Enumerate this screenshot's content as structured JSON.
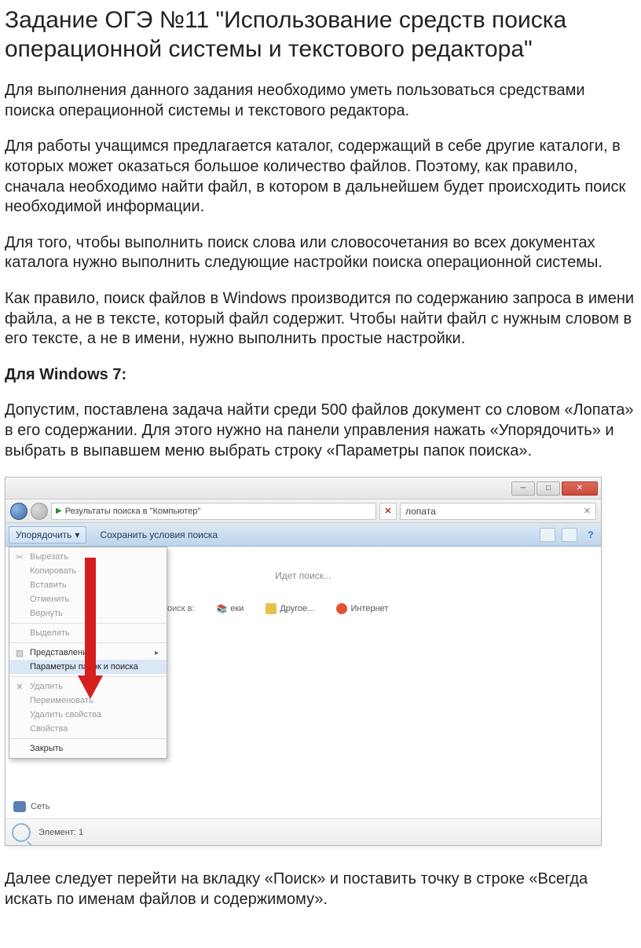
{
  "title": "Задание ОГЭ №11 \"Использование средств поиска операционной системы и текстового редактора\"",
  "p1": "Для выполнения данного задания необходимо уметь пользоваться средствами поиска операционной системы и текстового редактора.",
  "p2": "Для работы учащимся предлагается каталог, содержащий в себе другие каталоги, в которых может оказаться большое количество файлов. Поэтому, как правило, сначала необходимо найти файл, в котором в дальнейшем будет происходить поиск необходимой информации.",
  "p3": "Для того, чтобы выполнить поиск слова или словосочетания во всех документах каталога нужно выполнить следующие настройки поиска операционной системы.",
  "p4": "Как правило, поиск файлов в Windows производится по содержанию запроса в имени файла, а не в тексте, который файл содержит. Чтобы найти файл с нужным словом в его тексте, а не в имени, нужно выполнить простые настройки.",
  "h_w7": "Для Windows 7:",
  "p5": "Допустим, поставлена задача найти среди 500 файлов документ со словом «Лопата» в его содержании. Для этого нужно на панели управления нажать «Упорядочить» и выбрать в выпавшем меню выбрать строку «Параметры папок  поиска».",
  "p6": "Далее следует перейти на вкладку «Поиск» и поставить точку в строке «Всегда искать по именам файлов и содержимому».",
  "win": {
    "crumb": "Результаты поиска в \"Компьютер\"",
    "search": "лопата",
    "toolbar": {
      "organize": "Упорядочить",
      "save": "Сохранить условия поиска"
    },
    "searching": "Идет поиск...",
    "cat_label": "оиск в:",
    "cats": {
      "lib": "еки",
      "other": "Другое...",
      "net": "Интернет"
    },
    "menu": {
      "cut": "Вырезать",
      "copy": "Копировать",
      "paste": "Вставить",
      "undo": "Отменить",
      "redo": "Вернуть",
      "select": "Выделить",
      "view": "Представление",
      "params": "Параметры папок и поиска",
      "delete": "Удалить",
      "rename": "Переименовать",
      "delprops": "Удалить свойства",
      "props": "Свойства",
      "close": "Закрыть"
    },
    "side_net": "Сеть",
    "status": "Элемент: 1"
  }
}
